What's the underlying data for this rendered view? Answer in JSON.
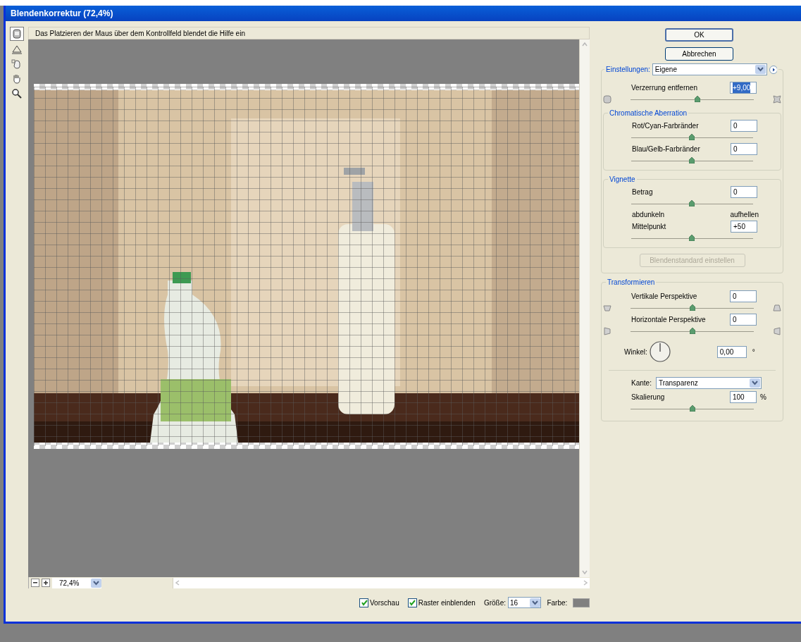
{
  "window": {
    "title": "Blendenkorrektur (72,4%)"
  },
  "tools": [
    {
      "kind": "remove-distortion",
      "selected": true
    },
    {
      "kind": "straighten",
      "selected": false
    },
    {
      "kind": "move-grid",
      "selected": false
    },
    {
      "kind": "hand",
      "selected": false
    },
    {
      "kind": "zoom",
      "selected": false
    }
  ],
  "hint": "Das Platzieren der Maus über dem Kontrollfeld blendet die Hilfe ein",
  "zoom": {
    "value": "72,4%"
  },
  "buttons": [
    {
      "label": "OK",
      "default": true
    },
    {
      "label": "Abbrechen",
      "default": false
    }
  ],
  "settings": {
    "label": "Einstellungen:",
    "value": "Eigene"
  },
  "distortion": {
    "label": "Verzerrung entfernen",
    "value": "+9,00",
    "level": 0.54
  },
  "chromatic": {
    "title": "Chromatische Aberration",
    "sliders": [
      {
        "label": "Rot/Cyan-Farbränder",
        "value": "0",
        "level": 0.5
      },
      {
        "label": "Blau/Gelb-Farbränder",
        "value": "0",
        "level": 0.5
      }
    ]
  },
  "vignette": {
    "title": "Vignette",
    "amount": {
      "label": "Betrag",
      "value": "0",
      "level": 0.5,
      "min_label": "abdunkeln",
      "max_label": "aufhellen"
    },
    "midpoint": {
      "label": "Mittelpunkt",
      "value": "+50",
      "level": 0.5
    }
  },
  "lens_default_button": {
    "label": "Blendenstandard einstellen",
    "disabled": true
  },
  "transform": {
    "title": "Transformieren",
    "sliders": [
      {
        "kind": "vertical",
        "label": "Vertikale Perspektive",
        "value": "0",
        "level": 0.5
      },
      {
        "kind": "horizontal",
        "label": "Horizontale Perspektive",
        "value": "0",
        "level": 0.5
      }
    ],
    "angle": {
      "label": "Winkel:",
      "value": "0,00",
      "unit": "°"
    },
    "edge": {
      "label": "Kante:",
      "value": "Transparenz"
    },
    "scale": {
      "label": "Skalierung",
      "value": "100",
      "unit": "%",
      "level": 0.5
    }
  },
  "bottom": {
    "checkboxes": [
      {
        "label": "Vorschau",
        "checked": true
      },
      {
        "label": "Raster einblenden",
        "checked": true
      }
    ],
    "size": {
      "label": "Größe:",
      "value": "16"
    },
    "color": {
      "label": "Farbe:",
      "color": "#808080"
    }
  }
}
